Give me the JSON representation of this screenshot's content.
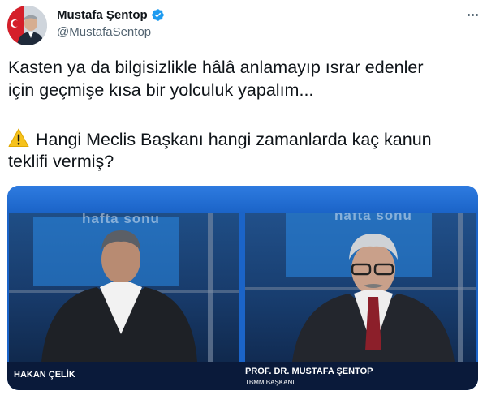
{
  "author": {
    "name": "Mustafa Şentop",
    "handle": "@MustafaSentop",
    "verified": true
  },
  "tweet": {
    "lines": [
      "Kasten ya da bilgisizlikle hâlâ anlamayıp ısrar edenler",
      "için geçmişe kısa bir yolculuk yapalım...",
      "Hangi Meclis Başkanı hangi zamanlarda kaç kanun",
      "teklifi vermiş?"
    ],
    "warning_icon": "warning-icon"
  },
  "media": {
    "watermark": "hafta sonu",
    "left_caption": "HAKAN ÇELİK",
    "right_caption": "PROF. DR. MUSTAFA ŞENTOP",
    "right_subcaption": "TBMM BAŞKANI"
  },
  "colors": {
    "text": "#0f1419",
    "secondary": "#536471",
    "verified": "#1d9bf0",
    "media_blue": "#1b64c8"
  }
}
